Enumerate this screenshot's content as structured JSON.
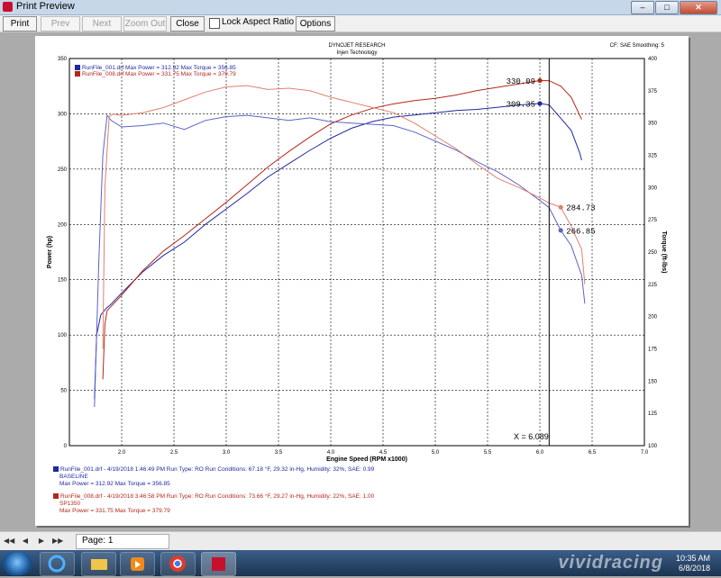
{
  "window": {
    "title": "Print Preview"
  },
  "toolbar": {
    "print": "Print",
    "prev": "Prev",
    "next": "Next",
    "zoom_out": "Zoom Out",
    "close": "Close",
    "lock_aspect": "Lock Aspect Ratio",
    "options": "Options"
  },
  "report": {
    "title": "DYNOJET RESEARCH",
    "subtitle": "Injen Technology",
    "corner": "CF: SAE  Smoothing: 5",
    "cursor": "X = 6.089"
  },
  "chart_data": {
    "type": "line",
    "title": "DYNOJET RESEARCH",
    "subtitle": "Injen Technology",
    "xlabel": "Engine Speed (RPM x1000)",
    "ylabel": "Power (hp)",
    "y2label": "Torque (ft-lbs)",
    "xlim": [
      1.5,
      7.0
    ],
    "ylim": [
      0,
      350
    ],
    "y2lim": [
      100,
      400
    ],
    "x_ticks": [
      "2.0",
      "2.5",
      "3.0",
      "3.5",
      "4.0",
      "4.5",
      "5.0",
      "5.5",
      "6.0",
      "6.5",
      "7.0"
    ],
    "y_ticks": [
      "0",
      "50",
      "100",
      "150",
      "200",
      "250",
      "300",
      "350"
    ],
    "y2_ticks": [
      "100",
      "125",
      "150",
      "175",
      "200",
      "225",
      "250",
      "275",
      "300",
      "325",
      "350",
      "375",
      "400"
    ],
    "grid": true,
    "cursor_x": 6.089,
    "legend_position": "top-left",
    "series": [
      {
        "name": "RunFile_001.drf",
        "kind": "power",
        "axis": "left",
        "color": "#1f2a9e",
        "x": [
          1.74,
          1.76,
          1.8,
          1.85,
          1.9,
          2.0,
          2.2,
          2.4,
          2.6,
          2.8,
          3.0,
          3.2,
          3.4,
          3.6,
          3.8,
          4.0,
          4.2,
          4.4,
          4.6,
          4.8,
          5.0,
          5.2,
          5.4,
          5.6,
          5.8,
          6.0,
          6.089,
          6.2,
          6.3,
          6.38,
          6.4
        ],
        "y": [
          42,
          100,
          118,
          124,
          128,
          138,
          157,
          172,
          184,
          200,
          214,
          228,
          243,
          255,
          267,
          278,
          287,
          293,
          297,
          299,
          301,
          303,
          304,
          306,
          308,
          309.35,
          308,
          296,
          285,
          265,
          258
        ]
      },
      {
        "name": "RunFile_008.drf",
        "kind": "power",
        "axis": "left",
        "color": "#b3271c",
        "x": [
          1.82,
          1.84,
          1.86,
          1.9,
          2.0,
          2.2,
          2.4,
          2.6,
          2.8,
          3.0,
          3.2,
          3.4,
          3.6,
          3.8,
          4.0,
          4.2,
          4.4,
          4.6,
          4.8,
          5.0,
          5.2,
          5.4,
          5.6,
          5.8,
          6.0,
          6.089,
          6.2,
          6.3,
          6.4
        ],
        "y": [
          60,
          110,
          122,
          126,
          136,
          158,
          176,
          190,
          205,
          220,
          236,
          252,
          266,
          279,
          291,
          299,
          305,
          309,
          312,
          314,
          317,
          321,
          324,
          327,
          330.09,
          330,
          325,
          315,
          295
        ]
      },
      {
        "name": "RunFile_001.drf",
        "kind": "torque",
        "axis": "right",
        "color": "#5a63c8",
        "x": [
          1.74,
          1.78,
          1.82,
          1.86,
          1.9,
          2.0,
          2.2,
          2.4,
          2.6,
          2.8,
          3.0,
          3.2,
          3.4,
          3.6,
          3.8,
          4.0,
          4.2,
          4.4,
          4.6,
          4.8,
          5.0,
          5.2,
          5.4,
          5.6,
          5.8,
          6.0,
          6.089,
          6.2,
          6.3,
          6.4,
          6.43
        ],
        "y": [
          130,
          240,
          325,
          356,
          352,
          347,
          348,
          350,
          345,
          352,
          355,
          356,
          354,
          352,
          354,
          351,
          350,
          349,
          348,
          343,
          336,
          329,
          320,
          312,
          302,
          290,
          284.5,
          266.85,
          255,
          232,
          210
        ]
      },
      {
        "name": "RunFile_008.drf",
        "kind": "torque",
        "axis": "right",
        "color": "#e0806e",
        "x": [
          1.82,
          1.84,
          1.88,
          1.92,
          2.0,
          2.2,
          2.4,
          2.6,
          2.8,
          3.0,
          3.2,
          3.4,
          3.6,
          3.8,
          4.0,
          4.2,
          4.4,
          4.6,
          4.8,
          5.0,
          5.2,
          5.4,
          5.6,
          5.8,
          6.0,
          6.089,
          6.2,
          6.3,
          6.4,
          6.43
        ],
        "y": [
          175,
          300,
          355,
          357,
          356,
          358,
          362,
          368,
          374,
          378,
          379,
          376,
          377,
          375,
          370,
          366,
          362,
          358,
          350,
          340,
          330,
          318,
          307,
          300,
          292,
          288,
          284.73,
          270,
          252,
          225
        ]
      }
    ],
    "data_labels": [
      {
        "text": "330.09",
        "x": 6.0,
        "y": 330.09,
        "axis": "left",
        "color": "#b3271c"
      },
      {
        "text": "309.35",
        "x": 6.0,
        "y": 309.35,
        "axis": "left",
        "color": "#1f2a9e"
      },
      {
        "text": "284.73",
        "x": 6.2,
        "y": 284.73,
        "axis": "right",
        "color": "#e0806e"
      },
      {
        "text": "266.85",
        "x": 6.2,
        "y": 266.85,
        "axis": "right",
        "color": "#5a63c8"
      }
    ]
  },
  "inset_legend": [
    {
      "text": "RunFile_001.drf Max Power = 312.92   Max Torque = 356.85",
      "color": "#1f2a9e"
    },
    {
      "text": "RunFile_008.drf Max Power = 331.75   Max Torque = 379.79",
      "color": "#b3271c"
    }
  ],
  "run_details": [
    {
      "line1": "RunFile_001.drf - 4/19/2018 1:46:49 PM  Run Type: RO  Run Conditions: 67.18 °F, 29.32 in-Hg,  Humidity:  32%, SAE: 0.99",
      "line2": "BASELINE",
      "line3": "Max Power = 312.92  Max Torque = 356.85",
      "color": "#1f2a9e"
    },
    {
      "line1": "RunFile_008.drf - 4/19/2018 3:46:58 PM  Run Type: RO  Run Conditions: 73.66 °F, 29.27 in-Hg,  Humidity:  22%, SAE: 1.00",
      "line2": "SP1350",
      "line3": "Max Power = 331.75  Max Torque = 379.79",
      "color": "#b3271c"
    }
  ],
  "statusbar": {
    "page": "Page: 1"
  },
  "taskbar": {
    "time": "10:35 AM",
    "date": "6/8/2018"
  },
  "watermark": "vividracing"
}
